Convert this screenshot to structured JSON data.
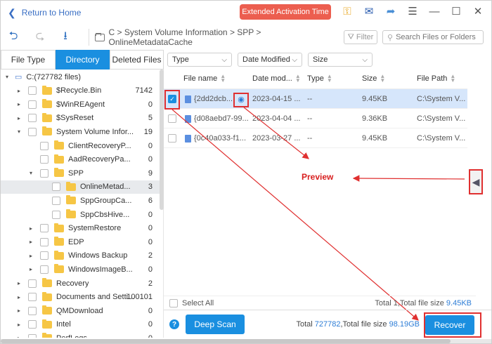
{
  "titlebar": {
    "return_label": "Return to Home",
    "promo_label": "Extended Activation Time"
  },
  "toolbar": {
    "breadcrumb": "C > System Volume Information > SPP > OnlineMetadataCache",
    "filter_label": "Filter",
    "search_placeholder": "Search Files or Folders"
  },
  "tabs": [
    "File Type",
    "Directory",
    "Deleted Files"
  ],
  "filters": {
    "type": "Type",
    "date_modified": "Date Modified",
    "size": "Size"
  },
  "tree": [
    {
      "name": "C:(727782 files)",
      "count": "",
      "level": 0,
      "expand": "down",
      "drive": true
    },
    {
      "name": "$Recycle.Bin",
      "count": "7142",
      "level": 1,
      "expand": "right"
    },
    {
      "name": "$WinREAgent",
      "count": "0",
      "level": 1,
      "expand": "right"
    },
    {
      "name": "$SysReset",
      "count": "5",
      "level": 1,
      "expand": "right"
    },
    {
      "name": "System Volume Infor...",
      "count": "19",
      "level": 1,
      "expand": "down"
    },
    {
      "name": "ClientRecoveryP...",
      "count": "0",
      "level": 2,
      "expand": ""
    },
    {
      "name": "AadRecoveryPa...",
      "count": "0",
      "level": 2,
      "expand": ""
    },
    {
      "name": "SPP",
      "count": "9",
      "level": 2,
      "expand": "down"
    },
    {
      "name": "OnlineMetad...",
      "count": "3",
      "level": 3,
      "expand": "",
      "selected": true
    },
    {
      "name": "SppGroupCa...",
      "count": "6",
      "level": 3,
      "expand": ""
    },
    {
      "name": "SppCbsHive...",
      "count": "0",
      "level": 3,
      "expand": ""
    },
    {
      "name": "SystemRestore",
      "count": "0",
      "level": 2,
      "expand": "right"
    },
    {
      "name": "EDP",
      "count": "0",
      "level": 2,
      "expand": "right"
    },
    {
      "name": "Windows Backup",
      "count": "2",
      "level": 2,
      "expand": "right"
    },
    {
      "name": "WindowsImageB...",
      "count": "0",
      "level": 2,
      "expand": "right"
    },
    {
      "name": "Recovery",
      "count": "2",
      "level": 1,
      "expand": "right"
    },
    {
      "name": "Documents and Setti...",
      "count": "100101",
      "level": 1,
      "expand": "right"
    },
    {
      "name": "QMDownload",
      "count": "0",
      "level": 1,
      "expand": "right"
    },
    {
      "name": "Intel",
      "count": "0",
      "level": 1,
      "expand": "right"
    },
    {
      "name": "PerfLogs",
      "count": "0",
      "level": 1,
      "expand": "right"
    }
  ],
  "columns": [
    "File name",
    "Date mod...",
    "Type",
    "Size",
    "File Path"
  ],
  "files": [
    {
      "name": "{2dd2dcb...",
      "date": "2023-04-15 ...",
      "type": "--",
      "size": "9.45KB",
      "path": "C:\\System V...",
      "checked": true
    },
    {
      "name": "{d08aebd7-99...",
      "date": "2023-04-04 ...",
      "type": "--",
      "size": "9.36KB",
      "path": "C:\\System V...",
      "checked": false
    },
    {
      "name": "{0c40a033-f1...",
      "date": "2023-03-27 ...",
      "type": "--",
      "size": "9.45KB",
      "path": "C:\\System V...",
      "checked": false
    }
  ],
  "annotation": {
    "preview_label": "Preview"
  },
  "selection": {
    "select_all_label": "Select All",
    "summary_prefix": "Total 1,Total file size ",
    "summary_size": "9.45KB"
  },
  "footer": {
    "help": "?",
    "deep_scan_label": "Deep Scan",
    "total_prefix": "Total ",
    "total_count": "727782",
    "total_mid": ",Total file size ",
    "total_size": "98.19GB",
    "recover_label": "Recover"
  },
  "colors": {
    "accent": "#1a8fe0",
    "promo": "#ec5e4f",
    "annotation": "#e03030"
  }
}
